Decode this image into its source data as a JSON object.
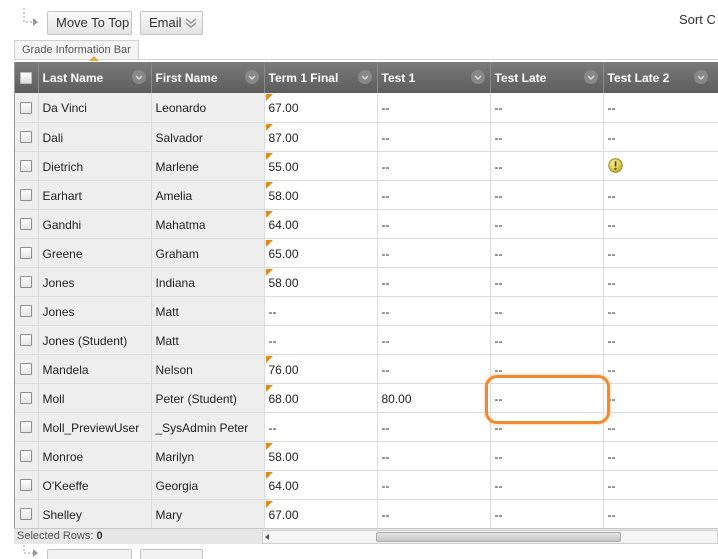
{
  "toolbar": {
    "move_to_top_label": "Move To Top",
    "email_label": "Email",
    "sort_label": "Sort C"
  },
  "info_bar": {
    "tab_label": "Grade Information Bar"
  },
  "grid": {
    "columns": [
      "Last Name",
      "First Name",
      "Term 1 Final",
      "Test 1",
      "Test Late",
      "Test Late 2"
    ],
    "rows": [
      {
        "last": "Da Vinci",
        "first": "Leonardo",
        "term1": "67.00",
        "test1": "--",
        "late": "--",
        "late2": "--",
        "flag": true
      },
      {
        "last": "Dali",
        "first": "Salvador",
        "term1": "87.00",
        "test1": "--",
        "late": "--",
        "late2": "--",
        "flag": true
      },
      {
        "last": "Dietrich",
        "first": "Marlene",
        "term1": "55.00",
        "test1": "--",
        "late": "--",
        "late2": "",
        "flag": true,
        "late2_icon": "needs-grading-icon"
      },
      {
        "last": "Earhart",
        "first": "Amelia",
        "term1": "58.00",
        "test1": "--",
        "late": "--",
        "late2": "--",
        "flag": true
      },
      {
        "last": "Gandhi",
        "first": "Mahatma",
        "term1": "64.00",
        "test1": "--",
        "late": "--",
        "late2": "--",
        "flag": true
      },
      {
        "last": "Greene",
        "first": "Graham",
        "term1": "65.00",
        "test1": "--",
        "late": "--",
        "late2": "--",
        "flag": true
      },
      {
        "last": "Jones",
        "first": "Indiana",
        "term1": "58.00",
        "test1": "--",
        "late": "--",
        "late2": "--",
        "flag": true
      },
      {
        "last": "Jones",
        "first": "Matt",
        "term1": "--",
        "test1": "--",
        "late": "--",
        "late2": "--",
        "flag": false
      },
      {
        "last": "Jones (Student)",
        "first": "Matt",
        "term1": "--",
        "test1": "--",
        "late": "--",
        "late2": "--",
        "flag": false
      },
      {
        "last": "Mandela",
        "first": "Nelson",
        "term1": "76.00",
        "test1": "--",
        "late": "--",
        "late2": "--",
        "flag": true
      },
      {
        "last": "Moll",
        "first": "Peter (Student)",
        "term1": "68.00",
        "test1": "80.00",
        "late": "--",
        "late2": "--",
        "flag": true
      },
      {
        "last": "Moll_PreviewUser",
        "first": "_SysAdmin Peter",
        "term1": "--",
        "test1": "--",
        "late": "--",
        "late2": "--",
        "flag": false
      },
      {
        "last": "Monroe",
        "first": "Marilyn",
        "term1": "58.00",
        "test1": "--",
        "late": "--",
        "late2": "--",
        "flag": true
      },
      {
        "last": "O'Keeffe",
        "first": "Georgia",
        "term1": "64.00",
        "test1": "--",
        "late": "--",
        "late2": "--",
        "flag": true
      },
      {
        "last": "Shelley",
        "first": "Mary",
        "term1": "67.00",
        "test1": "--",
        "late": "--",
        "late2": "--",
        "flag": true
      }
    ]
  },
  "footer": {
    "selected_rows_label": "Selected Rows:",
    "selected_rows_count": "0"
  },
  "colors": {
    "header_bg": "#6b6b6b",
    "flag": "#e08a17",
    "highlight": "#ef8a2e",
    "name_cell_bg": "#eeeeee"
  }
}
